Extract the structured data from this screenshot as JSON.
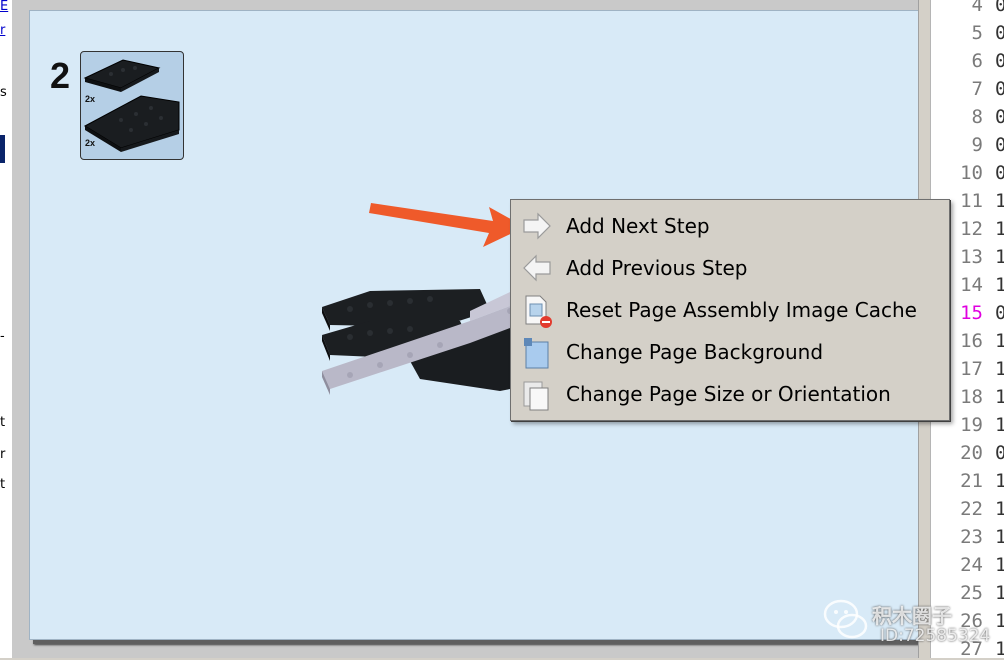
{
  "left_strip": {
    "fragments": [
      "E",
      "r",
      "s",
      "-",
      "t",
      "r",
      "t"
    ]
  },
  "page": {
    "step_number": "2",
    "parts_list": {
      "items": [
        {
          "quantity": "2x",
          "color": "#1a1d20",
          "shape": "plate"
        },
        {
          "quantity": "2x",
          "color": "#1a1d20",
          "shape": "wedge-plate"
        }
      ]
    }
  },
  "context_menu": {
    "items": [
      {
        "label": "Add Next Step",
        "icon": "arrow-right-icon"
      },
      {
        "label": "Add Previous Step",
        "icon": "arrow-left-icon"
      },
      {
        "label": "Reset Page Assembly Image Cache",
        "icon": "reset-cache-icon"
      },
      {
        "label": "Change Page Background",
        "icon": "page-background-icon"
      },
      {
        "label": "Change Page Size or Orientation",
        "icon": "page-size-icon"
      }
    ]
  },
  "line_numbers": {
    "numbers": [
      "4",
      "5",
      "6",
      "7",
      "8",
      "9",
      "10",
      "11",
      "12",
      "13",
      "14",
      "15",
      "16",
      "17",
      "18",
      "19",
      "20",
      "21",
      "22",
      "23",
      "24",
      "25",
      "26",
      "27"
    ],
    "active": "15",
    "code_column": [
      "0",
      "0",
      "0",
      "0",
      "0",
      "0",
      "0",
      "1",
      "1",
      "1",
      "1",
      "0",
      "1",
      "1",
      "1",
      "1",
      "0",
      "1",
      "1",
      "1",
      "1",
      "1",
      "1",
      "1"
    ]
  },
  "watermark": {
    "line1": "积木圈子",
    "line2": "ID:72585324"
  },
  "colors": {
    "page_background": "#d8eaf7",
    "annotation_arrow": "#ef5a2a",
    "menu_background": "#d4d0c8",
    "active_line_number": "#e000e0"
  }
}
